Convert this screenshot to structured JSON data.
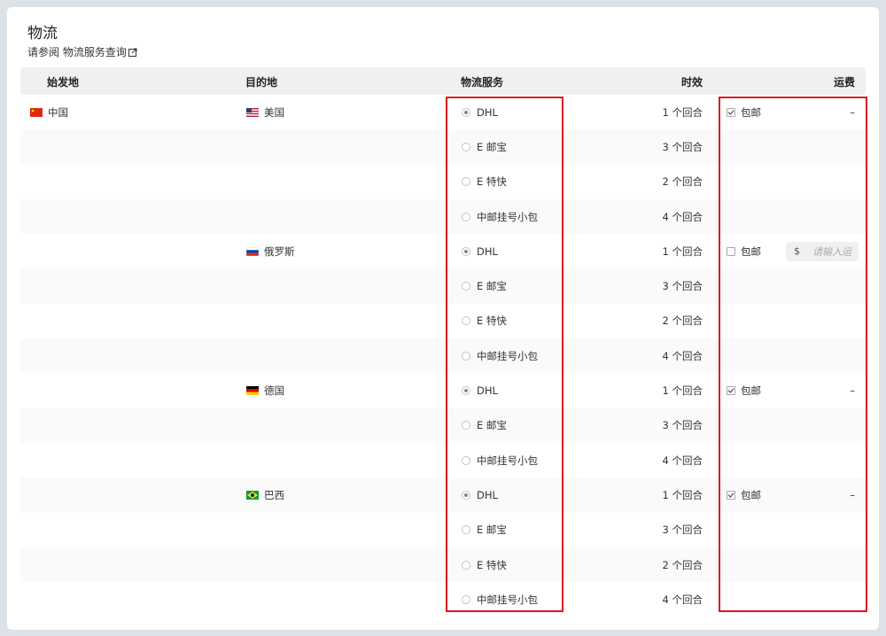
{
  "header": {
    "title": "物流",
    "subtitle": "请参阅 物流服务查询"
  },
  "columns": {
    "origin": "始发地",
    "destination": "目的地",
    "service": "物流服务",
    "time": "时效",
    "fee": "运费"
  },
  "rows": [
    {
      "origin": "中国",
      "destination": "美国",
      "flag": "us",
      "service": "DHL",
      "selected": true,
      "time": "1 个回合",
      "fee_free": "包邮",
      "fee_checked": true,
      "fee_dash": "–"
    },
    {
      "service": "E 邮宝",
      "selected": false,
      "time": "3 个回合"
    },
    {
      "service": "E 特快",
      "selected": false,
      "time": "2 个回合"
    },
    {
      "service": "中邮挂号小包",
      "selected": false,
      "time": "4 个回合"
    },
    {
      "destination": "俄罗斯",
      "flag": "ru",
      "service": "DHL",
      "selected": true,
      "time": "1 个回合",
      "fee_free": "包邮",
      "fee_checked": false,
      "fee_currency": "$",
      "fee_placeholder": "请输入运"
    },
    {
      "service": "E 邮宝",
      "selected": false,
      "time": "3 个回合"
    },
    {
      "service": "E 特快",
      "selected": false,
      "time": "2 个回合"
    },
    {
      "service": "中邮挂号小包",
      "selected": false,
      "time": "4 个回合"
    },
    {
      "destination": "德国",
      "flag": "de",
      "service": "DHL",
      "selected": true,
      "time": "1 个回合",
      "fee_free": "包邮",
      "fee_checked": true,
      "fee_dash": "–"
    },
    {
      "service": "E 邮宝",
      "selected": false,
      "time": "3 个回合"
    },
    {
      "service": "中邮挂号小包",
      "selected": false,
      "time": "4 个回合"
    },
    {
      "destination": "巴西",
      "flag": "br",
      "service": "DHL",
      "selected": true,
      "time": "1 个回合",
      "fee_free": "包邮",
      "fee_checked": true,
      "fee_dash": "–"
    },
    {
      "service": "E 邮宝",
      "selected": false,
      "time": "3 个回合"
    },
    {
      "service": "E 特快",
      "selected": false,
      "time": "2 个回合"
    },
    {
      "service": "中邮挂号小包",
      "selected": false,
      "time": "4 个回合"
    }
  ],
  "colors": {
    "highlight": "#e0141e",
    "header_bg": "#f0f0f0",
    "page_bg": "#dde2e8"
  }
}
